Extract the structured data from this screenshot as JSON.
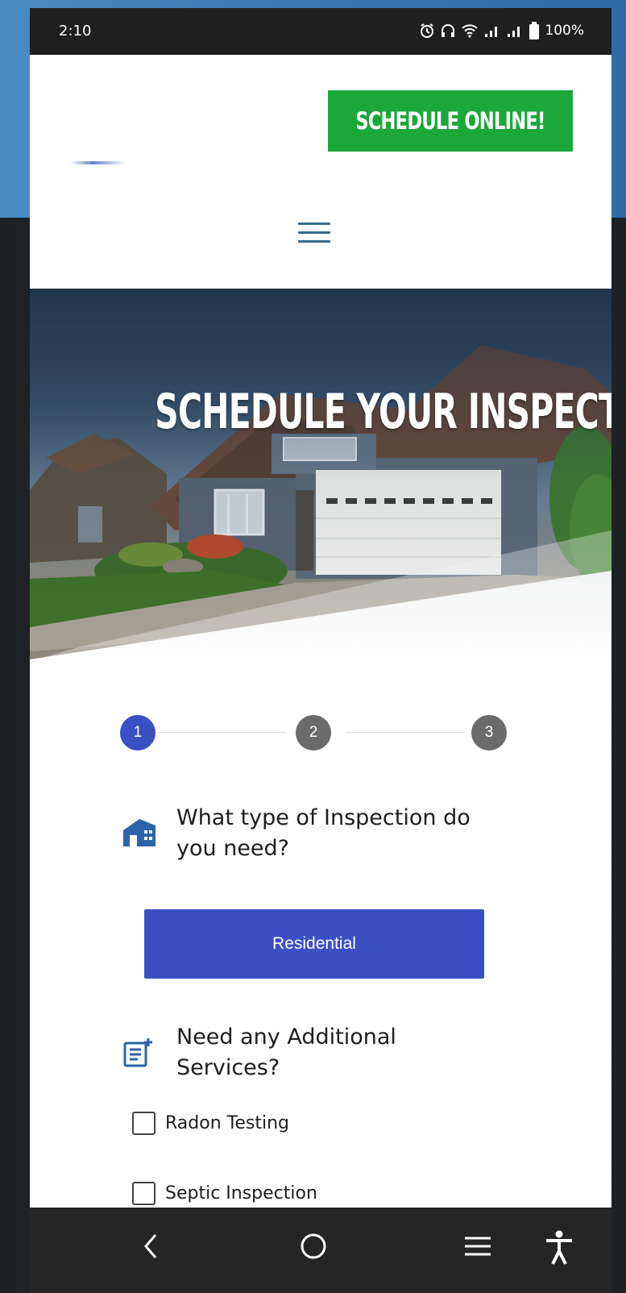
{
  "status_bar": {
    "time": "2:10",
    "battery": "100%",
    "icons": [
      "alarm-icon",
      "headphones-icon",
      "wifi-icon",
      "signal-icon",
      "signal-icon",
      "battery-icon"
    ]
  },
  "header": {
    "cta_label": "SCHEDULE ONLINE!",
    "cta_color": "#1aa83a",
    "menu_icon": "hamburger-icon"
  },
  "hero": {
    "title": "SCHEDULE YOUR INSPECTION"
  },
  "steps": {
    "items": [
      "1",
      "2",
      "3"
    ],
    "active": 1,
    "active_color": "#3b4fc4"
  },
  "form": {
    "question1": {
      "icon": "house-icon",
      "text": "What type of Inspection do you need?"
    },
    "selected_option": "Residential",
    "question2": {
      "icon": "add-list-icon",
      "text": "Need any Additional Services?"
    },
    "services": [
      {
        "label": "Radon Testing",
        "checked": false
      },
      {
        "label": "Septic Inspection",
        "checked": false
      }
    ]
  },
  "nav_bar": {
    "buttons": [
      "back-icon",
      "home-icon",
      "recents-icon",
      "accessibility-icon"
    ]
  }
}
